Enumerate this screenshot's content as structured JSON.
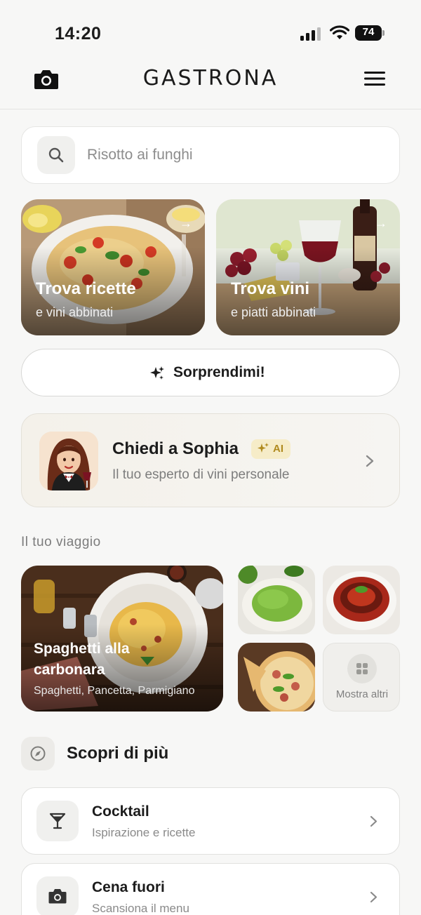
{
  "status_bar": {
    "time": "14:20",
    "battery": "74"
  },
  "header": {
    "logo": "GASTRONA",
    "camera_icon": "camera-icon",
    "menu_icon": "menu-icon"
  },
  "search": {
    "placeholder": "Risotto ai funghi",
    "icon": "search-icon"
  },
  "feature_cards": [
    {
      "title": "Trova ricette",
      "subtitle": "e vini abbinati",
      "icon": "arrow-right-icon"
    },
    {
      "title": "Trova vini",
      "subtitle": "e piatti abbinati",
      "icon": "arrow-right-icon"
    }
  ],
  "surprise": {
    "label": "Sorprendimi!",
    "icon": "sparkle-icon"
  },
  "sophia": {
    "name": "Chiedi a Sophia",
    "badge": "AI",
    "description": "Il tuo esperto di vini personale"
  },
  "journey": {
    "title": "Il tuo viaggio",
    "featured": {
      "title": "Spaghetti alla carbonara",
      "ingredients": "Spaghetti, Pancetta, Parmigiano"
    },
    "more_label": "Mostra altri"
  },
  "discover": {
    "title": "Scopri di più",
    "items": [
      {
        "title": "Cocktail",
        "subtitle": "Ispirazione e ricette",
        "icon": "cocktail-icon"
      },
      {
        "title": "Cena fuori",
        "subtitle": "Scansiona il menu",
        "icon": "camera-icon"
      }
    ]
  },
  "colors": {
    "background": "#f7f7f6",
    "accent_gold": "#b08a1e",
    "text": "#1c1c1c"
  }
}
